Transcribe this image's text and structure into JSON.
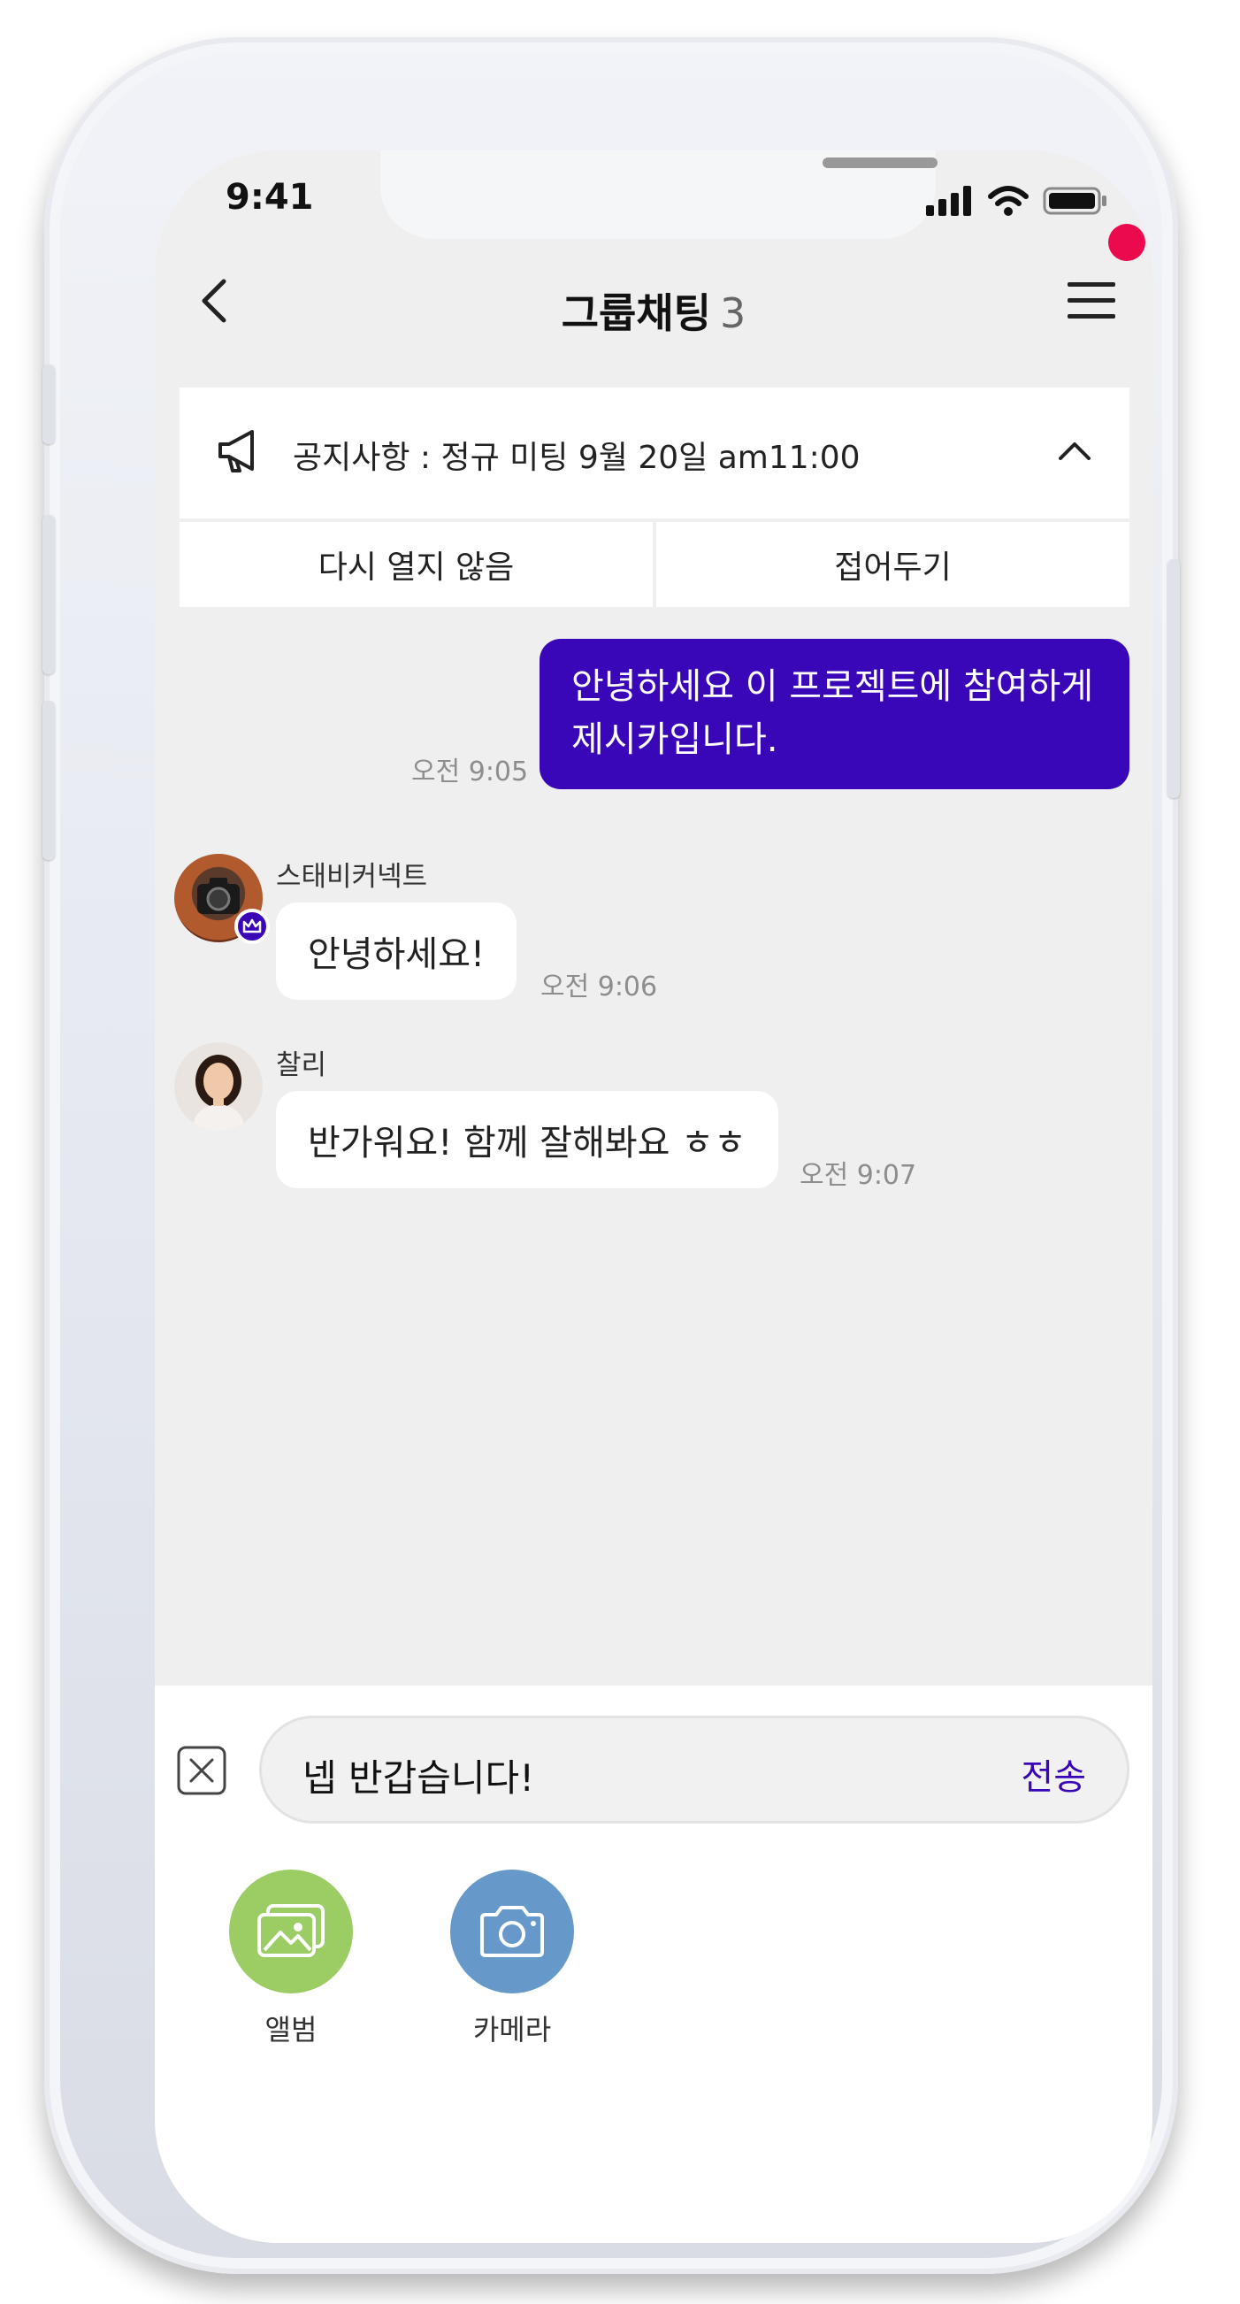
{
  "status": {
    "time": "9:41"
  },
  "header": {
    "back_icon": "chevron-left-icon",
    "title": "그룹채팅",
    "member_count": "3",
    "menu_icon": "hamburger-menu-icon"
  },
  "notice": {
    "icon": "megaphone-icon",
    "text": "공지사항 : 정규 미팅 9월 20일 am11:00",
    "toggle_icon": "chevron-up-icon",
    "actions": [
      "다시 열지 않음",
      "접어두기"
    ]
  },
  "messages": [
    {
      "side": "out",
      "text_line1": "안녕하세요 이 프로젝트에 참여하게",
      "text_line2": "제시카입니다.",
      "time": "오전 9:05"
    },
    {
      "side": "in",
      "sender": "스태비커넥트",
      "badge_icon": "crown-icon",
      "text": "안녕하세요!",
      "time": "오전 9:06"
    },
    {
      "side": "in",
      "sender": "찰리",
      "text": "반가워요! 함께 잘해봐요 ㅎㅎ",
      "time": "오전 9:07"
    }
  ],
  "composer": {
    "value": "넵 반갑습니다!",
    "send_label": "전송",
    "clear_icon": "close-box-icon"
  },
  "attachments": [
    {
      "label": "앨범",
      "icon": "gallery-icon",
      "color": "#9ccc64"
    },
    {
      "label": "카메라",
      "icon": "camera-icon",
      "color": "#6698c9"
    }
  ],
  "colors": {
    "accent": "#3a07b8",
    "notification_dot": "#ec0a4f"
  }
}
